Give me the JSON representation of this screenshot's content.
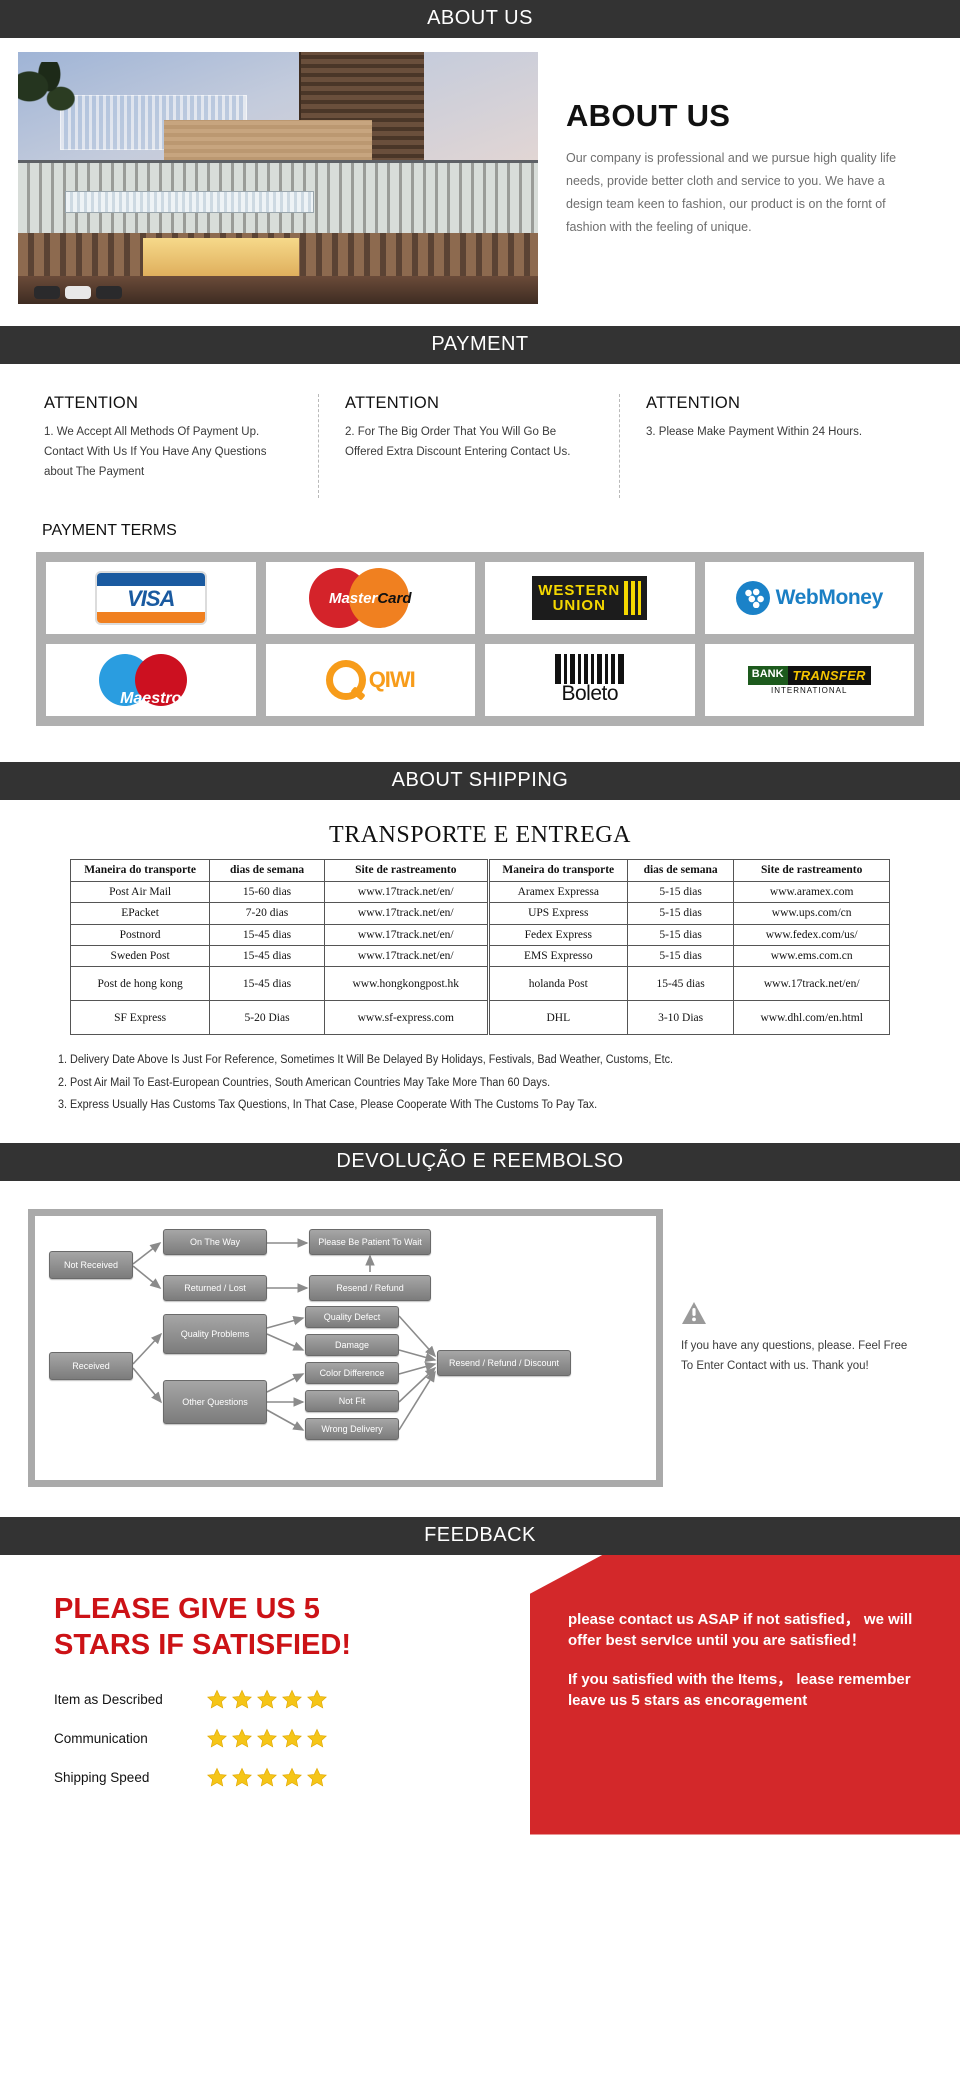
{
  "sections": {
    "about": {
      "banner": "ABOUT US"
    },
    "payment": {
      "banner": "PAYMENT"
    },
    "shipping": {
      "banner": "ABOUT SHIPPING"
    },
    "refund": {
      "banner": "DEVOLUÇÃO E REEMBOLSO"
    },
    "feedback": {
      "banner": "FEEDBACK"
    }
  },
  "about": {
    "title": "ABOUT US",
    "body": "Our company is professional and we pursue high quality life needs, provide better cloth and service to you. We have a design team keen to fashion, our product is on the fornt of fashion with the feeling of unique."
  },
  "payment": {
    "attention": [
      {
        "title": "ATTENTION",
        "body": "1.  We Accept All Methods Of Payment Up. Contact With Us If You Have Any Questions about The Payment"
      },
      {
        "title": "ATTENTION",
        "body": "2. For The Big Order That You Will Go Be Offered Extra Discount Entering Contact Us."
      },
      {
        "title": "ATTENTION",
        "body": "3.  Please Make Payment Within 24 Hours."
      }
    ],
    "terms_title": "PAYMENT TERMS",
    "logos": [
      {
        "name": "visa",
        "label": "VISA"
      },
      {
        "name": "mastercard",
        "label_a": "Master",
        "label_b": "Card"
      },
      {
        "name": "western-union",
        "label_a": "WESTERN",
        "label_b": "UNION"
      },
      {
        "name": "webmoney",
        "label": "WebMoney"
      },
      {
        "name": "maestro",
        "label": "Maestro"
      },
      {
        "name": "qiwi",
        "label": "QIWI"
      },
      {
        "name": "boleto",
        "label": "Boleto"
      },
      {
        "name": "bank-transfer",
        "label_a": "BANK",
        "label_b": "TRANSFER",
        "label_c": "INTERNATIONAL"
      }
    ]
  },
  "shipping": {
    "title": "TRANSPORTE E ENTREGA",
    "headers": [
      "Maneira do transporte",
      "dias de semana",
      "Site de rastreamento",
      "Maneira do transporte",
      "dias de semana",
      "Site de rastreamento"
    ],
    "rows": [
      [
        "Post Air Mail",
        "15-60 dias",
        "www.17track.net/en/",
        "Aramex Expressa",
        "5-15 dias",
        "www.aramex.com"
      ],
      [
        "EPacket",
        "7-20 dias",
        "www.17track.net/en/",
        "UPS Express",
        "5-15 dias",
        "www.ups.com/cn"
      ],
      [
        "Postnord",
        "15-45 dias",
        "www.17track.net/en/",
        "Fedex Express",
        "5-15 dias",
        "www.fedex.com/us/"
      ],
      [
        "Sweden Post",
        "15-45 dias",
        "www.17track.net/en/",
        "EMS Expresso",
        "5-15 dias",
        "www.ems.com.cn"
      ],
      [
        "Post de hong kong",
        "15-45 dias",
        "www.hongkongpost.hk",
        "holanda Post",
        "15-45 dias",
        "www.17track.net/en/"
      ],
      [
        "SF Express",
        "5-20 Dias",
        "www.sf-express.com",
        "DHL",
        "3-10 Dias",
        "www.dhl.com/en.html"
      ]
    ],
    "notes": [
      "1. Delivery Date Above Is Just For Reference, Sometimes It Will Be Delayed By Holidays, Festivals, Bad Weather, Customs, Etc.",
      "2. Post Air Mail To East-European Countries, South American Countries May Take More Than 60 Days.",
      "3. Express Usually Has Customs Tax Questions, In That Case, Please Cooperate With The Customs To Pay Tax."
    ]
  },
  "refund": {
    "nodes": {
      "not_received": "Not Received",
      "on_the_way": "On The Way",
      "returned_lost": "Returned / Lost",
      "be_patient": "Please Be Patient To Wait",
      "resend_refund": "Resend / Refund",
      "received": "Received",
      "quality_problems": "Quality Problems",
      "other_questions": "Other Questions",
      "quality_defect": "Quality Defect",
      "damage": "Damage",
      "color_difference": "Color Difference",
      "not_fit": "Not Fit",
      "wrong_delivery": "Wrong Delivery",
      "resend_refund_discount": "Resend / Refund / Discount"
    },
    "note": "If you have any questions, please. Feel Free To Enter Contact with us. Thank you!"
  },
  "feedback": {
    "headline_line1": "PLEASE GIVE US 5",
    "headline_line2": "STARS IF SATISFIED!",
    "ratings": [
      {
        "label": "Item as Described",
        "stars": 5
      },
      {
        "label": "Communication",
        "stars": 5
      },
      {
        "label": "Shipping Speed",
        "stars": 5
      }
    ],
    "panel_paragraph_1": "please contact us ASAP if not satisfied，  we will offer best servIce until you are satisfied！",
    "panel_paragraph_2": "If you satisfied with the Items， lease remember leave us 5 stars as encoragement"
  },
  "colors": {
    "banner_bg": "#333333",
    "brand_red": "#cc1216",
    "panel_red": "#d3282a",
    "star_yellow": "#f5c518",
    "node_gray": "#8e8e8e"
  }
}
